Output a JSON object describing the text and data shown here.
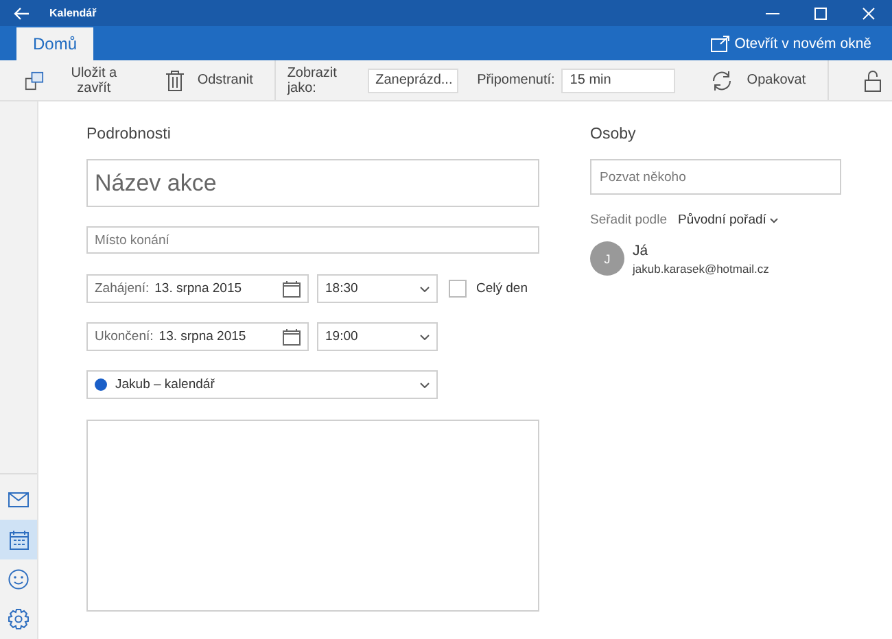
{
  "window": {
    "title": "Kalendář"
  },
  "tabs": [
    {
      "label": "Domů",
      "selected": true
    }
  ],
  "open_in_new_window": "Otevřít v novém okně",
  "toolbar": {
    "save": "Uložit a zavřít",
    "delete": "Odstranit",
    "show_as_label": "Zobrazit jako:",
    "show_as_value": "Zaneprázd...",
    "reminder_label": "Připomenutí:",
    "reminder_value": "15 min",
    "repeat": "Opakovat",
    "private": false
  },
  "details": {
    "heading": "Podrobnosti",
    "title_placeholder": "Název akce",
    "location_placeholder": "Místo konání",
    "start": {
      "label": "Zahájení:",
      "date": "13. srpna 2015",
      "time": "18:30"
    },
    "end": {
      "label": "Ukončení:",
      "date": "13. srpna 2015",
      "time": "19:00"
    },
    "all_day": {
      "label": "Celý den",
      "checked": false
    },
    "calendar": {
      "name": "Jakub – kalendář",
      "color": "#1a5fc8"
    }
  },
  "people": {
    "heading": "Osoby",
    "invite_placeholder": "Pozvat někoho",
    "sort_label": "Seřadit podle",
    "sort_value": "Původní pořadí",
    "attendees": [
      {
        "initial": "J",
        "name": "Já",
        "email": "jakub.karasek@hotmail.cz"
      }
    ]
  },
  "sidebar": {
    "items": [
      {
        "kind": "mail",
        "selected": false
      },
      {
        "kind": "calendar",
        "selected": true
      },
      {
        "kind": "people",
        "selected": false
      },
      {
        "kind": "settings",
        "selected": false
      }
    ]
  }
}
